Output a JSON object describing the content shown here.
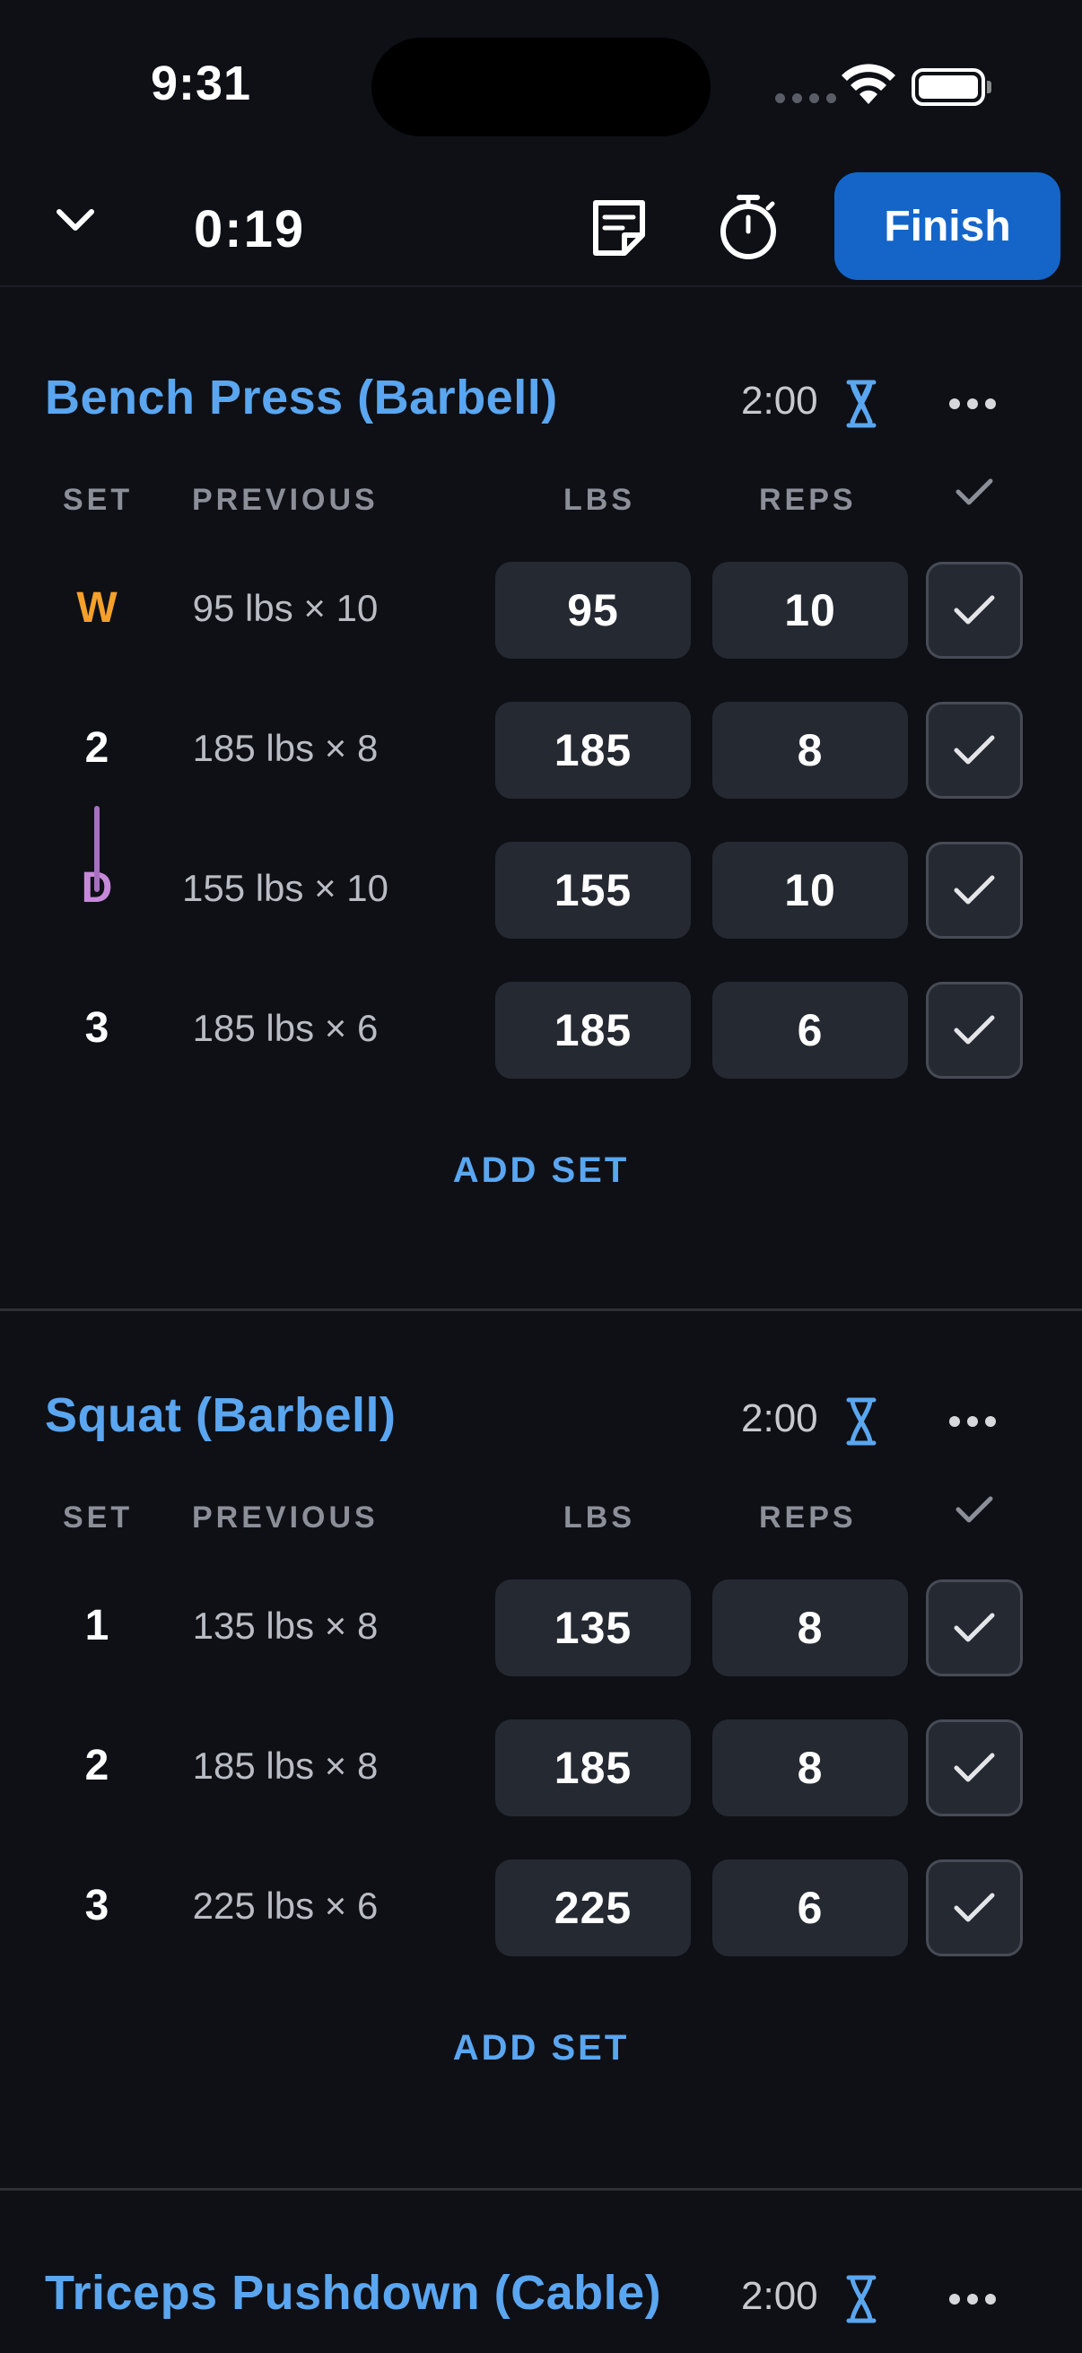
{
  "status_bar": {
    "time": "9:31"
  },
  "toolbar": {
    "elapsed": "0:19",
    "finish_label": "Finish"
  },
  "columns": {
    "set": "SET",
    "previous": "PREVIOUS",
    "lbs": "LBS",
    "reps": "REPS"
  },
  "exercises": [
    {
      "name": "Bench Press (Barbell)",
      "rest": "2:00",
      "add_set_label": "ADD SET",
      "sets": [
        {
          "label": "W",
          "type": "warmup",
          "previous": "95 lbs × 10",
          "lbs": "95",
          "reps": "10"
        },
        {
          "label": "2",
          "type": "normal",
          "previous": "185 lbs × 8",
          "lbs": "185",
          "reps": "8"
        },
        {
          "label": "D",
          "type": "drop",
          "previous": "155 lbs × 10",
          "lbs": "155",
          "reps": "10"
        },
        {
          "label": "3",
          "type": "normal",
          "previous": "185 lbs × 6",
          "lbs": "185",
          "reps": "6"
        }
      ]
    },
    {
      "name": "Squat (Barbell)",
      "rest": "2:00",
      "add_set_label": "ADD SET",
      "sets": [
        {
          "label": "1",
          "type": "normal",
          "previous": "135 lbs × 8",
          "lbs": "135",
          "reps": "8"
        },
        {
          "label": "2",
          "type": "normal",
          "previous": "185 lbs × 8",
          "lbs": "185",
          "reps": "8"
        },
        {
          "label": "3",
          "type": "normal",
          "previous": "225 lbs × 6",
          "lbs": "225",
          "reps": "6"
        }
      ]
    },
    {
      "name": "Triceps Pushdown (Cable)",
      "rest": "2:00"
    }
  ],
  "colors": {
    "background": "#0e1016",
    "accent": "#5aa6f0",
    "finish_button": "#1565c9",
    "warmup": "#f4a02a",
    "drop": "#c68ad8"
  },
  "icons": {
    "collapse": "chevron-down-icon",
    "notes": "note-icon",
    "timer": "stopwatch-icon",
    "rest": "hourglass-icon",
    "more": "ellipsis-icon",
    "complete": "checkmark-icon"
  }
}
